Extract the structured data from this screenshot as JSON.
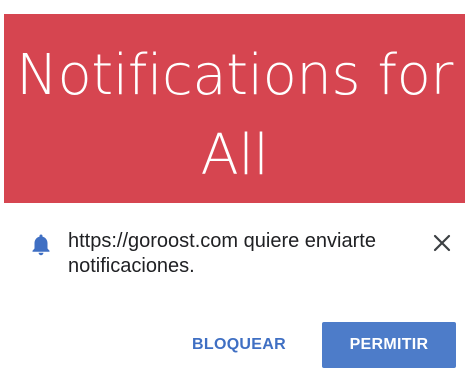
{
  "banner": {
    "title_line1": "Notifications for",
    "title_line2": "All",
    "background_color": "#d64550"
  },
  "prompt": {
    "icon": "bell-icon",
    "message": "https://goroost.com quiere enviarte notificaciones.",
    "close_icon": "close-icon",
    "block_label": "BLOQUEAR",
    "allow_label": "PERMITIR",
    "accent_color": "#4d7cc9"
  }
}
